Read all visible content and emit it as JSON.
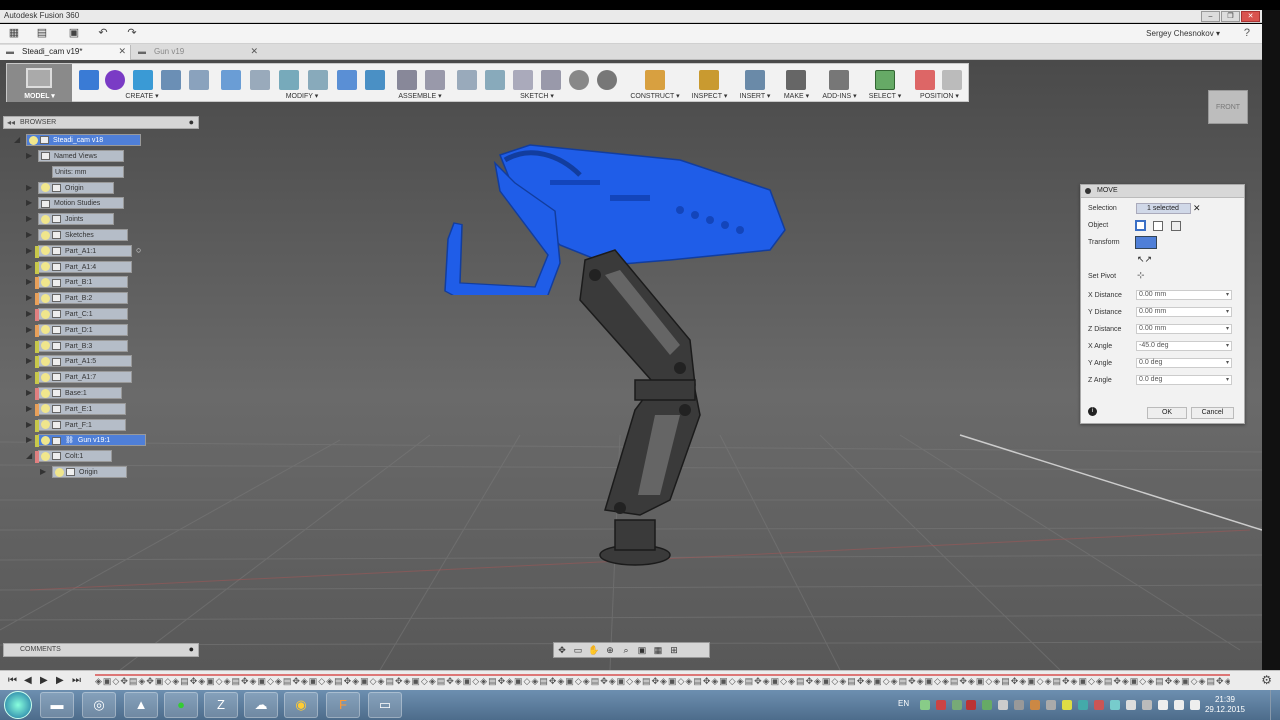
{
  "window": {
    "title": "Autodesk Fusion 360",
    "buttons": [
      "–",
      "❐",
      "✕"
    ]
  },
  "user": {
    "name": "Sergey Chesnokov ▾",
    "help": "?"
  },
  "quick_access": {
    "icons": [
      "grid-icon",
      "file-icon",
      "save-icon",
      "undo-icon",
      "redo-icon"
    ]
  },
  "tabs": [
    {
      "label": "Steadi_cam v19*",
      "active": true
    },
    {
      "label": "Gun v19",
      "active": false
    }
  ],
  "toolbar": {
    "workspace": "MODEL ▾",
    "groups": [
      "CREATE ▾",
      "MODIFY ▾",
      "ASSEMBLE ▾",
      "SKETCH ▾",
      "CONSTRUCT ▾",
      "INSPECT ▾",
      "INSERT ▾",
      "MAKE ▾",
      "ADD-INS ▾",
      "SELECT ▾",
      "POSITION ▾"
    ]
  },
  "viewcube": {
    "label": "FRONT"
  },
  "browser": {
    "title": "BROWSER",
    "root": "Steadi_cam v18",
    "items": [
      {
        "label": "Named Views"
      },
      {
        "label": "Units: mm"
      },
      {
        "label": "Origin"
      },
      {
        "label": "Motion Studies"
      },
      {
        "label": "Joints"
      },
      {
        "label": "Sketches"
      },
      {
        "label": "Part_A1:1"
      },
      {
        "label": "Part_A1:4"
      },
      {
        "label": "Part_B:1"
      },
      {
        "label": "Part_B:2"
      },
      {
        "label": "Part_C:1"
      },
      {
        "label": "Part_D:1"
      },
      {
        "label": "Part_B:3"
      },
      {
        "label": "Part_A1:5"
      },
      {
        "label": "Part_A1:7"
      },
      {
        "label": "Base:1"
      },
      {
        "label": "Part_E:1"
      },
      {
        "label": "Part_F:1"
      },
      {
        "label": "Gun v19:1"
      },
      {
        "label": "Colt:1"
      },
      {
        "label": "Origin"
      }
    ]
  },
  "move_dialog": {
    "title": "MOVE",
    "selection_label": "Selection",
    "selection_value": "1 selected",
    "object_label": "Object",
    "transform_label": "Transform",
    "set_pivot_label": "Set Pivot",
    "fields": [
      {
        "label": "X Distance",
        "value": "0.00 mm"
      },
      {
        "label": "Y Distance",
        "value": "0.00 mm"
      },
      {
        "label": "Z Distance",
        "value": "0.00 mm"
      },
      {
        "label": "X Angle",
        "value": "-45.0 deg"
      },
      {
        "label": "Y Angle",
        "value": "0.0 deg"
      },
      {
        "label": "Z Angle",
        "value": "0.0 deg"
      }
    ],
    "ok": "OK",
    "cancel": "Cancel"
  },
  "comments": {
    "title": "COMMENTS"
  },
  "taskbar": {
    "lang": "EN",
    "time": "21:39",
    "date": "29.12.2015",
    "apps": [
      "explorer-icon",
      "3ds-icon",
      "app-icon",
      "spotify-icon",
      "zbrush-icon",
      "cloud-icon",
      "chrome-icon",
      "fusion-icon",
      "display-icon"
    ]
  },
  "colors": {
    "accent": "#4f7fd8",
    "gun": "#1f5de8",
    "viewport": "#5a5a5a"
  }
}
